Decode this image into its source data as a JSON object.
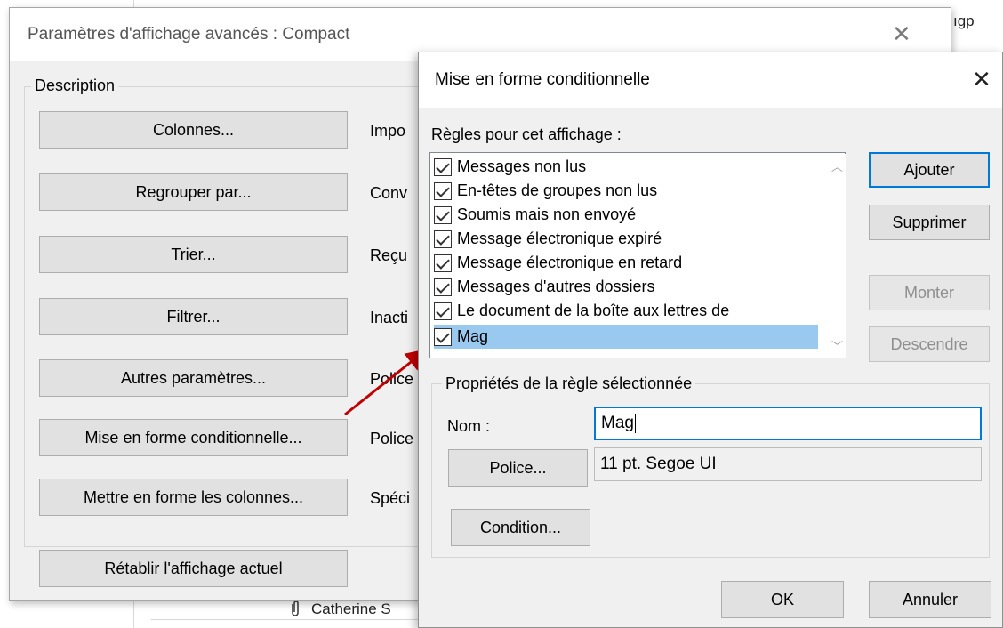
{
  "background": {
    "top_right_text": "ıgp",
    "bottom_text": "Catherine S",
    "attachment_icon": "paperclip-icon"
  },
  "advanced_view_dialog": {
    "title": "Paramètres d'affichage avancés : Compact",
    "group_label": "Description",
    "buttons": [
      {
        "label": "Colonnes...",
        "description": "Impo"
      },
      {
        "label": "Regrouper par...",
        "description": "Conv"
      },
      {
        "label": "Trier...",
        "description": "Reçu"
      },
      {
        "label": "Filtrer...",
        "description": "Inacti"
      },
      {
        "label": "Autres paramètres...",
        "description": "Police"
      },
      {
        "label": "Mise en forme conditionnelle...",
        "description": "Police"
      },
      {
        "label": "Mettre en forme les colonnes...",
        "description": "Spéci"
      }
    ],
    "reset_label": "Rétablir l'affichage actuel"
  },
  "conditional_format_dialog": {
    "title": "Mise en forme conditionnelle",
    "rules_label": "Règles pour cet affichage :",
    "rules": [
      {
        "label": "Messages non lus",
        "checked": true,
        "selected": false
      },
      {
        "label": "En-têtes de groupes non lus",
        "checked": true,
        "selected": false
      },
      {
        "label": "Soumis mais non envoyé",
        "checked": true,
        "selected": false
      },
      {
        "label": "Message électronique expiré",
        "checked": true,
        "selected": false
      },
      {
        "label": "Message électronique en retard",
        "checked": true,
        "selected": false
      },
      {
        "label": "Messages d'autres dossiers",
        "checked": true,
        "selected": false
      },
      {
        "label": "Le document de la boîte aux lettres de",
        "checked": true,
        "selected": false
      },
      {
        "label": "Mag",
        "checked": true,
        "selected": true
      }
    ],
    "buttons": {
      "add": "Ajouter",
      "delete": "Supprimer",
      "move_up": "Monter",
      "move_down": "Descendre"
    },
    "properties": {
      "group_label": "Propriétés de la règle sélectionnée",
      "name_label": "Nom :",
      "name_value": "Mag",
      "font_button": "Police...",
      "font_value": "11 pt. Segoe UI",
      "condition_button": "Condition..."
    },
    "ok": "OK",
    "cancel": "Annuler"
  },
  "colors": {
    "dialog_bg": "#f0f0f0",
    "selection": "#99c9ef",
    "focus_border": "#0078d7",
    "annotation_arrow": "#c00000"
  }
}
